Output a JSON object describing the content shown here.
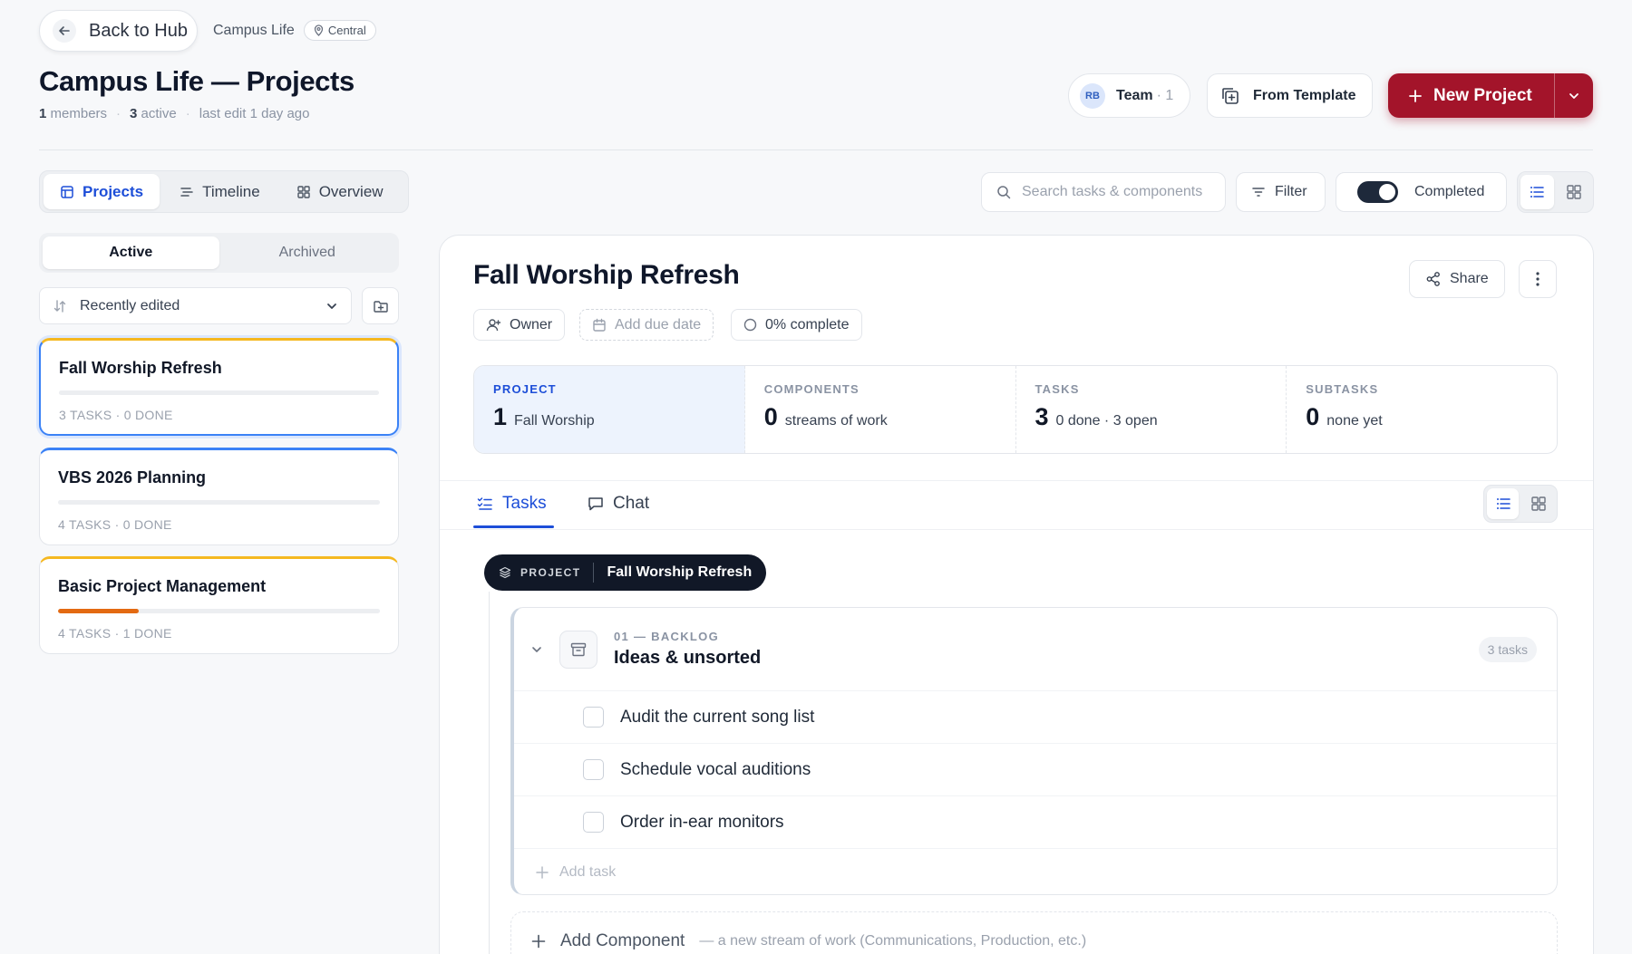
{
  "header": {
    "back_label": "Back to Hub",
    "breadcrumb": "Campus Life",
    "location": "Central",
    "title": "Campus Life — Projects",
    "meta": {
      "members_count": "1",
      "members_label": "members",
      "active_count": "3",
      "active_label": "active",
      "last_edit": "last edit 1 day ago"
    },
    "team": {
      "initials": "RB",
      "label": "Team",
      "count": "· 1"
    },
    "from_template": "From Template",
    "new_project": "New Project",
    "accent": "#a3142a"
  },
  "view_tabs": [
    {
      "label": "Projects",
      "active": true
    },
    {
      "label": "Timeline",
      "active": false
    },
    {
      "label": "Overview",
      "active": false
    }
  ],
  "toolbar": {
    "search_placeholder": "Search tasks & components",
    "filter": "Filter",
    "completed": "Completed"
  },
  "sidebar": {
    "segments": [
      "Active",
      "Archived"
    ],
    "sort_label": "Recently edited",
    "projects": [
      {
        "name": "Fall Worship Refresh",
        "meta": "3 TASKS · 0 DONE",
        "progress": 0
      },
      {
        "name": "VBS 2026 Planning",
        "meta": "4 TASKS · 0 DONE",
        "progress": 0
      },
      {
        "name": "Basic Project Management",
        "meta": "4 TASKS · 1 DONE",
        "progress": 0.25
      }
    ]
  },
  "project": {
    "title": "Fall Worship Refresh",
    "share": "Share",
    "owner": "Owner",
    "due": "Add due date",
    "complete": "0% complete",
    "stats": [
      {
        "key": "PROJECT",
        "num": "1",
        "desc": "Fall Worship"
      },
      {
        "key": "COMPONENTS",
        "num": "0",
        "desc": "streams of work"
      },
      {
        "key": "TASKS",
        "num": "3",
        "desc": "0 done · 3 open"
      },
      {
        "key": "SUBTASKS",
        "num": "0",
        "desc": "none yet"
      }
    ],
    "tabs": [
      "Tasks",
      "Chat"
    ],
    "pill_key": "PROJECT",
    "pill_value": "Fall Worship Refresh",
    "component": {
      "kicker": "01 — BACKLOG",
      "name": "Ideas & unsorted",
      "count": "3 tasks",
      "tasks": [
        "Audit the current song list",
        "Schedule vocal auditions",
        "Order in-ear monitors"
      ],
      "add_task": "Add task"
    },
    "add_component": "Add Component",
    "add_component_hint": "— a new stream of work (Communications, Production, etc.)"
  }
}
